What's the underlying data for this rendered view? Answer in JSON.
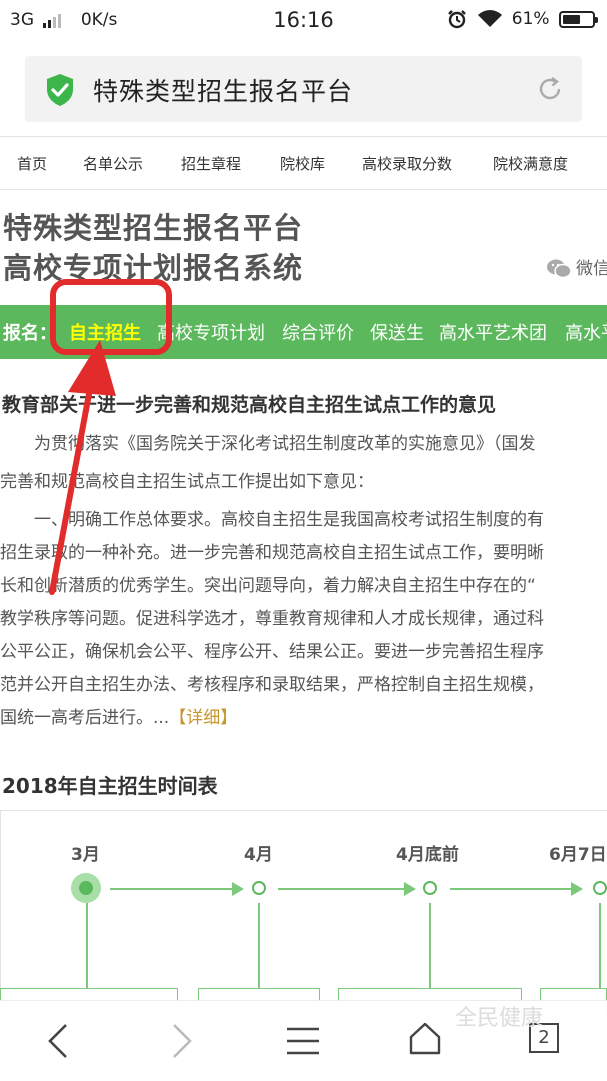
{
  "status_bar": {
    "network": "3G",
    "speed": "0K/s",
    "time": "16:16",
    "battery_percent": "61%",
    "battery_level": 0.61
  },
  "browser": {
    "address_title": "特殊类型招生报名平台"
  },
  "top_nav": [
    "首页",
    "名单公示",
    "招生章程",
    "院校库",
    "高校录取分数",
    "院校满意度"
  ],
  "site": {
    "title_line1": "特殊类型招生报名平台",
    "title_line2": "高校专项计划报名系统",
    "wechat_label": "微信"
  },
  "register_bar": {
    "lead": "报名：",
    "items": [
      "自主招生",
      "高校专项计划",
      "综合评价",
      "保送生",
      "高水平艺术团",
      "高水平"
    ],
    "active_index": 0
  },
  "article": {
    "title": "教育部关于进一步完善和规范高校自主招生试点工作的意见",
    "lines": [
      "　　为贯彻落实《国务院关于深化考试招生制度改革的实施意见》（国发",
      "完善和规范高校自主招生试点工作提出如下意见：",
      "　　一、明确工作总体要求。高校自主招生是我国高校考试招生制度的有",
      "招生录取的一种补充。进一步完善和规范高校自主招生试点工作，要明晰",
      "长和创新潜质的优秀学生。突出问题导向，着力解决自主招生中存在的“",
      "教学秩序等问题。促进科学选才，尊重教育规律和人才成长规律，通过科",
      "公平公正，确保机会公平、程序公开、结果公正。要进一步完善招生程序",
      "范并公开自主招生办法、考核程序和录取结果，严格控制自主招生规模，",
      "国统一高考后进行。..."
    ],
    "detail_link": "【详细】"
  },
  "schedule": {
    "title": "2018年自主招生时间表",
    "milestones": [
      "3月",
      "4月",
      "4月底前",
      "6月7日"
    ]
  },
  "bottom_bar": {
    "tab_count": "2",
    "watermark": "全民健康"
  },
  "colors": {
    "accent_green": "#5cb85c",
    "highlight_red": "#e22b2b",
    "active_yellow": "#ffff00",
    "link_gold": "#c8952a"
  }
}
